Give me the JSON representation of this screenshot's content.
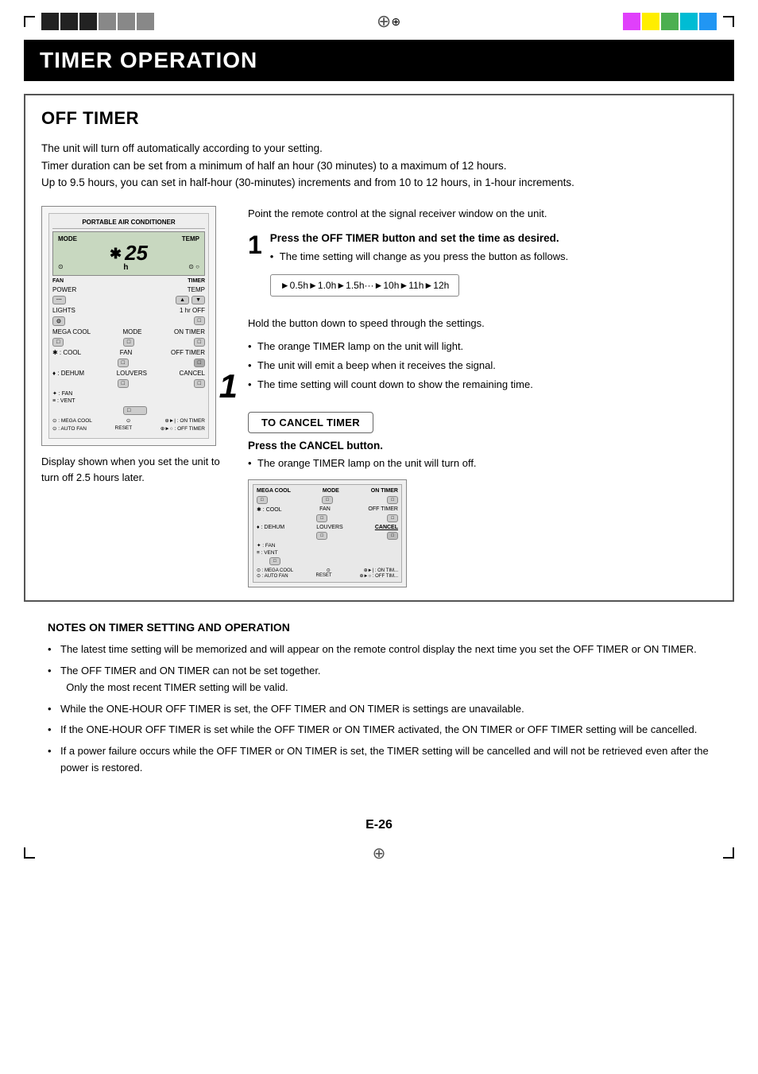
{
  "registration": {
    "top_left_corner": "corner",
    "top_right_corner": "corner",
    "crosshair": "⊕",
    "color_bars_right": [
      "magenta",
      "yellow",
      "green",
      "cyan",
      "blue"
    ],
    "black_bars_left": [
      "black",
      "black",
      "black",
      "gray",
      "gray",
      "gray"
    ]
  },
  "header": {
    "title": "TIMER OPERATION"
  },
  "off_timer": {
    "title": "OFF TIMER",
    "description_lines": [
      "The unit will turn off automatically according to your setting.",
      "Timer duration can be set from a minimum of half an hour (30 minutes) to a maximum of 12 hours.",
      "Up to 9.5 hours, you can set in half-hour (30-minutes) increments and from 10 to 12 hours, in 1-hour increments."
    ],
    "remote_label": "PORTABLE AIR CONDITIONER",
    "remote_mode": "MODE",
    "remote_temp": "TEMP",
    "remote_display_num": "25",
    "remote_display_h": "h",
    "remote_fan_label": "FAN",
    "remote_timer_label": "TIMER",
    "remote_power": "POWER",
    "remote_temp2": "TEMP",
    "remote_lights": "LIGHTS",
    "remote_1hr_off": "1 hr OFF",
    "remote_mega_cool": "MEGA COOL",
    "remote_mode2": "MODE",
    "remote_on_timer": "ON TIMER",
    "remote_cool": "✱ : COOL",
    "remote_fan2": "FAN",
    "remote_off_timer": "OFF TIMER",
    "remote_dehum": "♦ : DEHUM",
    "remote_fan3": "✦ : FAN",
    "remote_louvers": "LOUVERS",
    "remote_cancel": "CANCEL",
    "remote_vent": "≡ : VENT",
    "remote_mega_cool2": "⊙ : MEGA COOL",
    "remote_reset": "RESET",
    "remote_auto_fan": "⊙ : AUTO FAN",
    "remote_on_timer2": "⊕►| : ON TIMER",
    "remote_off_timer2": "⊕►○ : OFF TIMER",
    "step_number": "1",
    "point_text": "Point the remote control at the signal receiver window on the unit.",
    "step1_title": "Press the OFF TIMER button and set the time as desired.",
    "step1_bullet1": "The time setting will change as you press the button as follows.",
    "timer_sequence": "►0.5h►1.0h►1.5h···►10h►11h►12h",
    "hold_text": "Hold the button down to speed through the settings.",
    "bullet2": "The orange TIMER lamp on the unit will light.",
    "bullet3": "The unit will emit a beep when it receives the signal.",
    "bullet4": "The time setting will count down to show the remaining time.",
    "cancel_box_label": "TO CANCEL TIMER",
    "cancel_subtitle": "Press the CANCEL button.",
    "cancel_bullet": "The orange TIMER lamp on the unit will turn off.",
    "display_caption": "Display shown when you set the unit to turn off 2.5 hours later."
  },
  "notes": {
    "title": "NOTES ON TIMER SETTING AND OPERATION",
    "items": [
      "The latest time setting will be memorized and will appear on the remote control display the next time you set the OFF TIMER or ON TIMER.",
      "The OFF TIMER and ON TIMER can not be set together.\nOnly the most recent TIMER setting will be valid.",
      "While the  ONE-HOUR OFF TIMER is set, the OFF TIMER and ON TIMER is settings are unavailable.",
      "If the ONE-HOUR OFF TIMER is set while the OFF TIMER or ON TIMER activated, the  ON TIMER or OFF TIMER setting will be cancelled.",
      "If a power failure occurs while the OFF TIMER or ON TIMER is set, the TIMER setting will be cancelled and will not be retrieved even after the power is restored."
    ]
  },
  "page_number": "E-26"
}
